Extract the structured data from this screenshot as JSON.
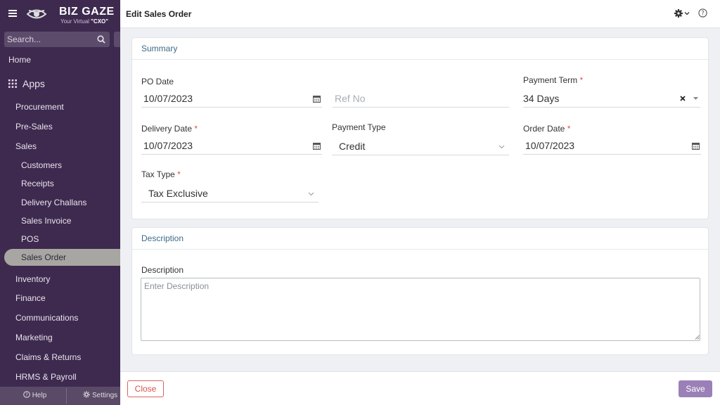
{
  "brand": {
    "name": "BIZ GAZE",
    "tagline_prefix": "Your Virtual ",
    "tagline_bold": "\"CXO\""
  },
  "search": {
    "placeholder": "Search..."
  },
  "sidebar": {
    "home": "Home",
    "apps": "Apps",
    "modules": [
      "Procurement",
      "Pre-Sales",
      "Sales"
    ],
    "sales_items": [
      "Customers",
      "Receipts",
      "Delivery Challans",
      "Sales Invoice",
      "POS",
      "Sales Order"
    ],
    "active_item": "Sales Order",
    "more_modules": [
      "Inventory",
      "Finance",
      "Communications",
      "Marketing",
      "Claims & Returns",
      "HRMS & Payroll"
    ],
    "footer": {
      "help": "Help",
      "settings": "Settings"
    }
  },
  "page": {
    "title": "Edit Sales Order"
  },
  "summary": {
    "heading": "Summary",
    "po_date": {
      "label": "PO Date",
      "value": "10/07/2023"
    },
    "ref_no": {
      "placeholder": "Ref No"
    },
    "payment_term": {
      "label": "Payment Term",
      "required": "*",
      "value": "34 Days"
    },
    "delivery_date": {
      "label": "Delivery Date",
      "required": "*",
      "value": "10/07/2023"
    },
    "payment_type": {
      "label": "Payment Type",
      "value": "Credit"
    },
    "order_date": {
      "label": "Order Date",
      "required": "*",
      "value": "10/07/2023"
    },
    "tax_type": {
      "label": "Tax Type",
      "required": "*",
      "value": "Tax Exclusive"
    }
  },
  "description": {
    "heading": "Description",
    "label": "Description",
    "placeholder": "Enter Description"
  },
  "actions": {
    "close": "Close",
    "save": "Save"
  },
  "colors": {
    "sidebar_bg": "#3e2a4f",
    "active_item_bg": "#a8a6a2",
    "section_heading": "#3c6b88",
    "required": "#d9534f",
    "close_border": "#e06060",
    "save_bg": "#9b80b8"
  },
  "icons": [
    "menu-icon",
    "bizgaze-logo",
    "search-icon",
    "apps-grid-icon",
    "help-icon",
    "gear-icon",
    "chevron-down-icon",
    "question-circle-icon",
    "calendar-icon",
    "clear-icon",
    "caret-down-icon",
    "resize-grip-icon"
  ]
}
